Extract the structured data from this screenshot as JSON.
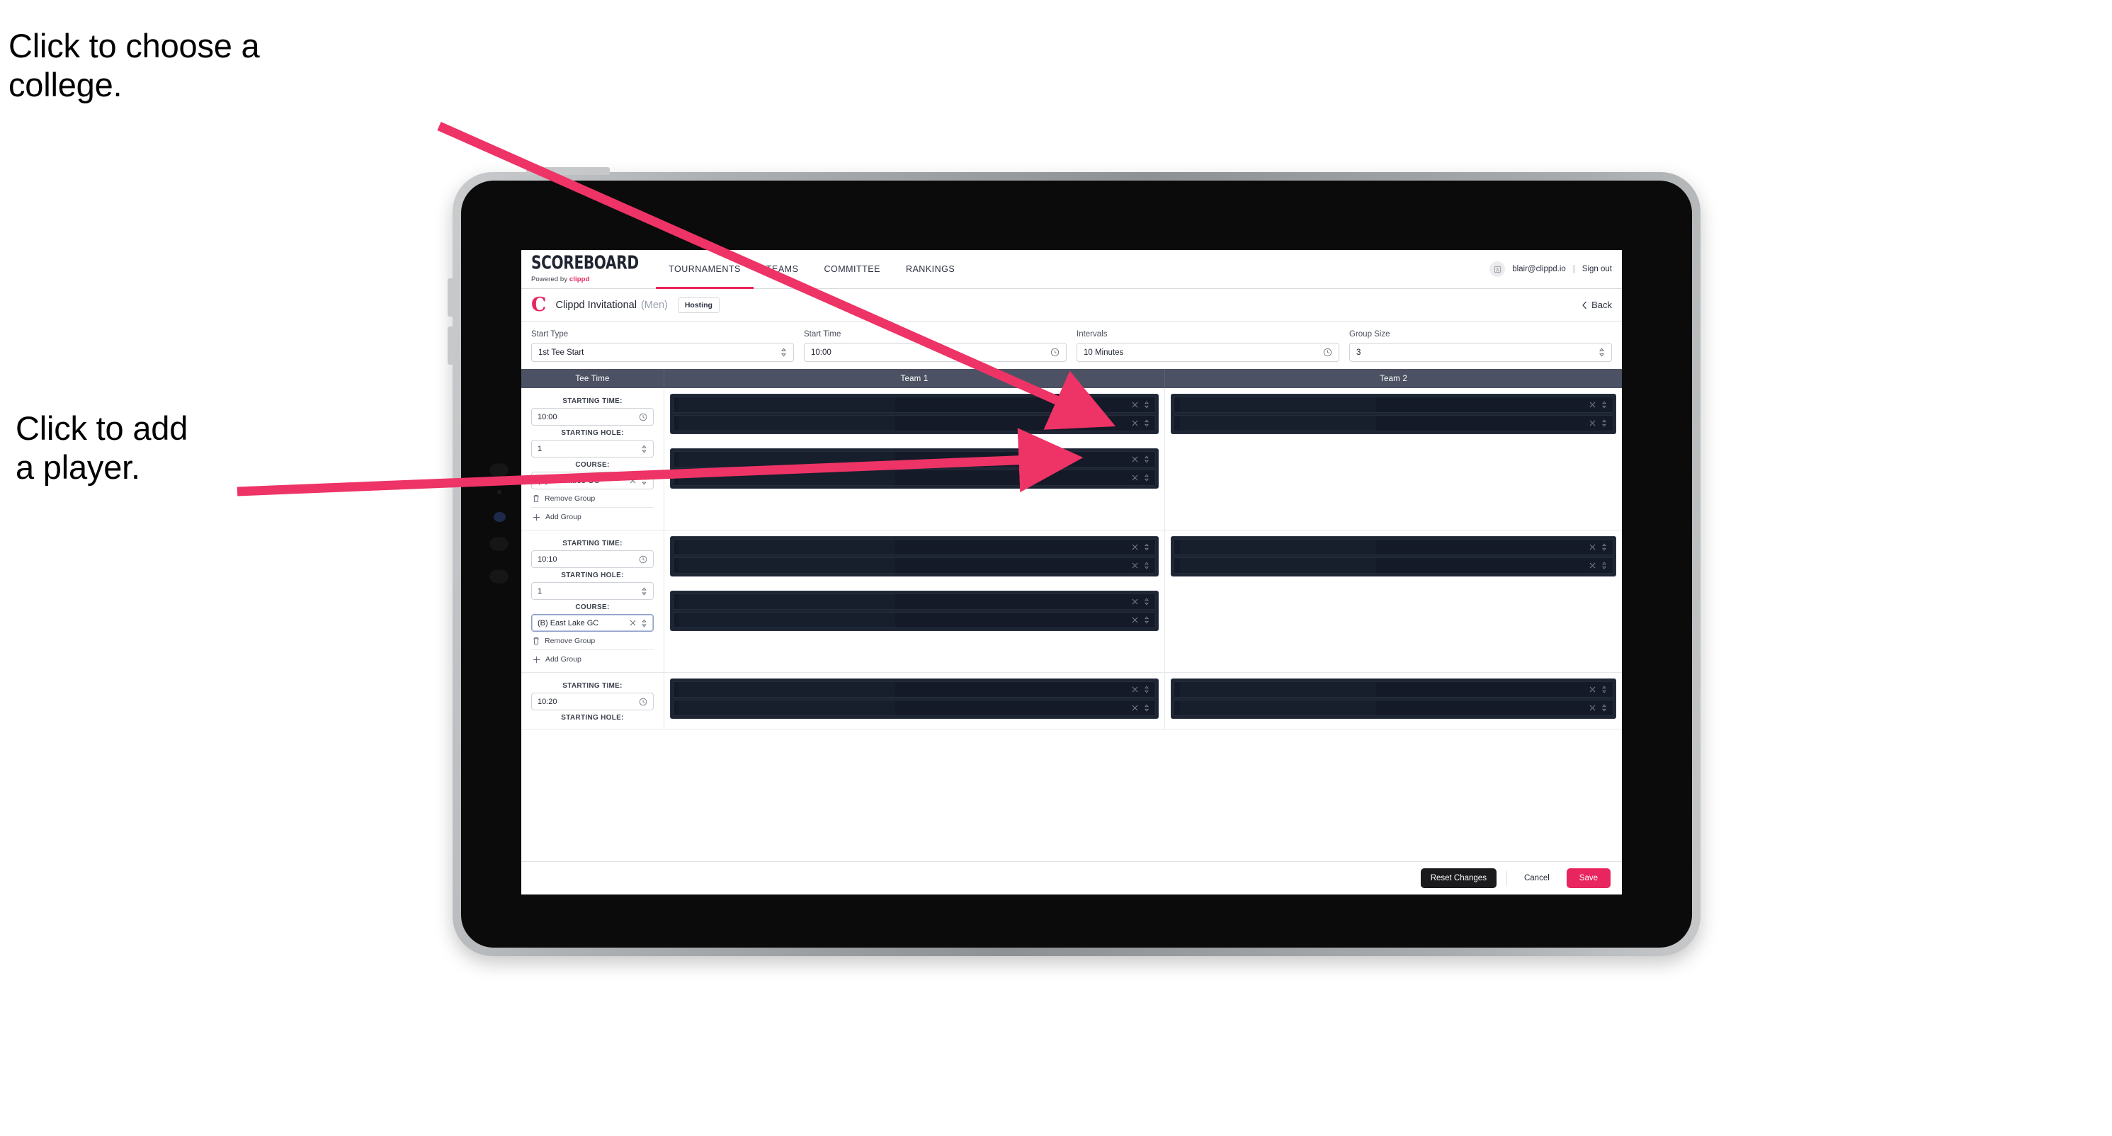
{
  "annotations": {
    "college": "Click to choose a\ncollege.",
    "player": "Click to add\na player."
  },
  "colors": {
    "accent": "#e8255e",
    "table_header": "#4c5263",
    "slot_dark": "#1d2432",
    "slot_row": "#141a27",
    "arrow": "#ee3366"
  },
  "navbar": {
    "brand_word": "SCOREBOARD",
    "brand_sub_prefix": "Powered by ",
    "brand_sub_name": "clippd",
    "items": [
      {
        "label": "TOURNAMENTS",
        "active": true
      },
      {
        "label": "TEAMS",
        "active": false
      },
      {
        "label": "COMMITTEE",
        "active": false
      },
      {
        "label": "RANKINGS",
        "active": false
      }
    ],
    "avatar_icon": "user-avatar-icon",
    "email": "blair@clippd.io",
    "separator": "|",
    "sign_out": "Sign out"
  },
  "tournament_bar": {
    "logo_letter": "C",
    "name": "Clippd Invitational",
    "gender": "(Men)",
    "status_pill": "Hosting",
    "back_label": "Back",
    "back_icon": "chevron-left-icon"
  },
  "controls": [
    {
      "label": "Start Type",
      "value": "1st Tee Start",
      "icon": "stepper-updown-icon"
    },
    {
      "label": "Start Time",
      "value": "10:00",
      "icon": "clock-icon"
    },
    {
      "label": "Intervals",
      "value": "10 Minutes",
      "icon": "clock-icon"
    },
    {
      "label": "Group Size",
      "value": "3",
      "icon": "stepper-updown-icon"
    }
  ],
  "table": {
    "headers": {
      "tee_time": "Tee Time",
      "team1": "Team 1",
      "team2": "Team 2"
    },
    "field_labels": {
      "starting_time": "STARTING TIME:",
      "starting_hole": "STARTING HOLE:",
      "course": "COURSE:"
    },
    "actions": {
      "remove_group": "Remove Group",
      "remove_icon": "trash-icon",
      "add_group": "Add Group",
      "add_icon": "plus-icon"
    },
    "slot_icons": {
      "clear": "close-x-icon",
      "expand": "stepper-updown-icon"
    },
    "groups": [
      {
        "starting_time": "10:00",
        "starting_hole": "1",
        "course": "(A) Peachtree GC",
        "course_focused": false,
        "team1_slots": [
          2,
          2
        ],
        "team2_slots": [
          2
        ]
      },
      {
        "starting_time": "10:10",
        "starting_hole": "1",
        "course": "(B) East Lake GC",
        "course_focused": true,
        "team1_slots": [
          2,
          2
        ],
        "team2_slots": [
          2
        ]
      },
      {
        "starting_time": "10:20",
        "starting_hole": "",
        "course": "",
        "course_focused": false,
        "team1_slots": [
          2
        ],
        "team2_slots": [
          2
        ]
      }
    ]
  },
  "footer": {
    "reset": "Reset Changes",
    "cancel": "Cancel",
    "save": "Save"
  }
}
